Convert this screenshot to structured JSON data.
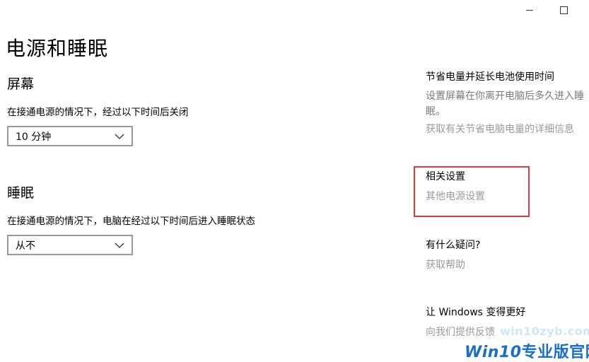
{
  "window": {
    "minimize_label": "",
    "maximize_label": ""
  },
  "page": {
    "title": "电源和睡眠"
  },
  "screen": {
    "title": "屏幕",
    "description": "在接通电源的情况下，经过以下时间后关闭",
    "selected_value": "10 分钟"
  },
  "sleep": {
    "title": "睡眠",
    "description": "在接通电源的情况下，电脑在经过以下时间后进入睡眠状态",
    "selected_value": "从不"
  },
  "sidebar": {
    "save_power": {
      "heading": "节省电量并延长电池使用时间",
      "text": "设置屏幕在你离开电脑后多久进入睡眠。",
      "link": "获取有关节省电脑电量的详细信息"
    },
    "related": {
      "heading": "相关设置",
      "link": "其他电源设置"
    },
    "questions": {
      "heading": "有什么疑问?",
      "link": "获取帮助"
    },
    "feedback": {
      "heading": "让 Windows 变得更好",
      "link": "向我们提供反馈"
    }
  },
  "watermark": {
    "url": "win10zyb.com",
    "brand_latin": "Win10",
    "brand_cn": "专业版官网"
  },
  "colors": {
    "highlight_border": "#e03a3a",
    "link_gray": "#9a9a9a",
    "watermark_blue": "#1a6fc3"
  }
}
